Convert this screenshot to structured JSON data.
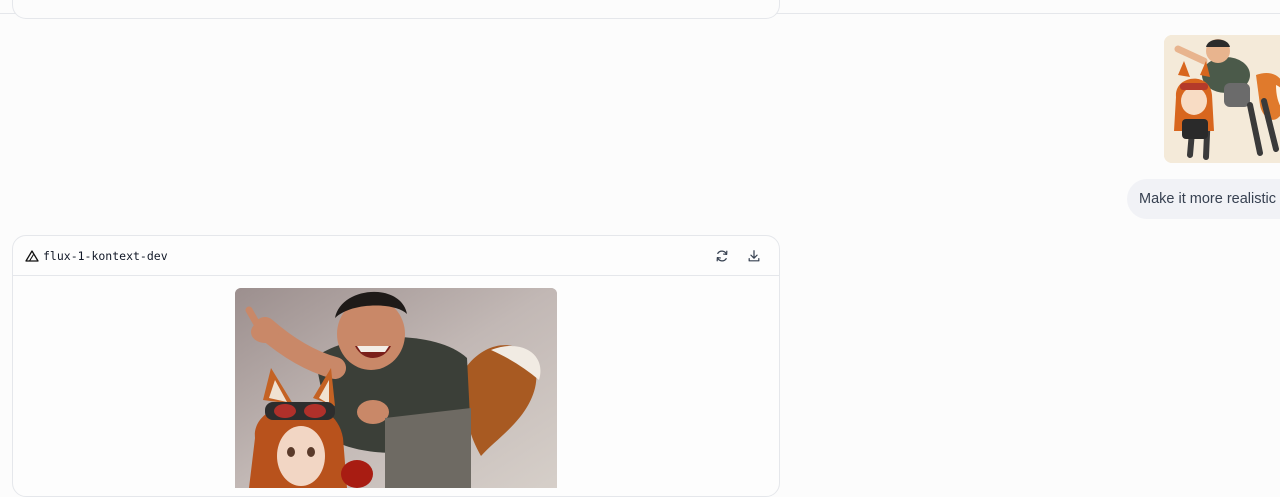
{
  "conversation": {
    "user_message": {
      "image_icon": "reference-image-thumbnail",
      "text": "Make it more realistic"
    },
    "assistant_card": {
      "model_name": "flux-1-kontext-dev",
      "model_icon": "triangle-logo-icon",
      "actions": [
        {
          "icon": "refresh-icon"
        },
        {
          "icon": "download-icon"
        }
      ],
      "image_icon": "generated-image"
    }
  }
}
